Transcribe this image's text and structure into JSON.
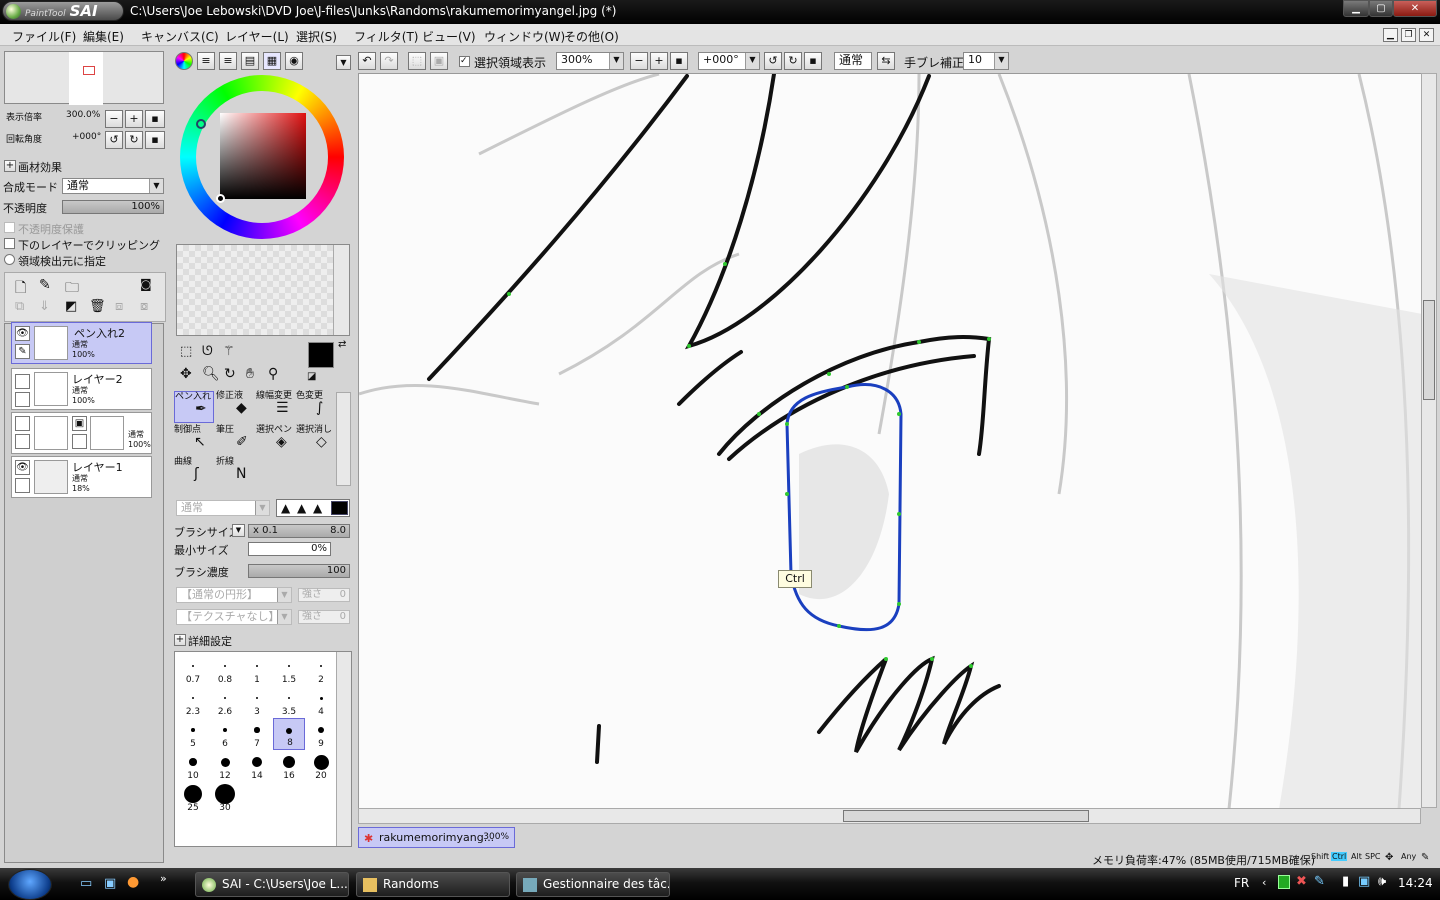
{
  "window": {
    "app_name": "PaintTool SAI",
    "title": "C:\\Users\\Joe Lebowski\\DVD Joe\\J-files\\Junks\\Randoms\\rakumemorimyangel.jpg (*)",
    "controls": [
      "minimize-icon",
      "maximize-icon",
      "close-icon"
    ]
  },
  "menu": {
    "items": [
      "ファイル(F)",
      "編集(E)",
      "キャンバス(C)",
      "レイヤー(L)",
      "選択(S)",
      "フィルタ(T)",
      "ビュー(V)",
      "ウィンドウ(W)",
      "その他(O)"
    ]
  },
  "navigator": {
    "zoom_label": "表示倍率",
    "zoom_value": "300.0%",
    "rotate_label": "回転角度",
    "rotate_value": "+000°"
  },
  "layer_props": {
    "effect_label": "画材効果",
    "blend_label": "合成モード",
    "blend_value": "通常",
    "opacity_label": "不透明度",
    "opacity_value": "100%",
    "opacity_fraction": 1.0,
    "protect_opacity": "不透明度保護",
    "clip_below": "下のレイヤーでクリッピング",
    "selection_source": "領域検出元に指定"
  },
  "layers": [
    {
      "name": "ペン入れ2",
      "mode": "通常",
      "opacity": "100%",
      "selected": true
    },
    {
      "name": "レイヤー2",
      "mode": "通常",
      "opacity": "100%",
      "selected": false
    },
    {
      "name": "",
      "mode": "通常",
      "opacity": "100%",
      "selected": false
    },
    {
      "name": "レイヤー1",
      "mode": "通常",
      "opacity": "18%",
      "selected": false
    }
  ],
  "tools": {
    "row1": [
      "ペン入れ",
      "修正液",
      "線幅変更",
      "色変更"
    ],
    "row2": [
      "制御点",
      "筆圧",
      "選択ペン",
      "選択消し"
    ],
    "row3": [
      "曲線",
      "折線"
    ]
  },
  "brush": {
    "mode_value": "通常",
    "size_label": "ブラシサイズ",
    "size_mult": "x 0.1",
    "size_value": "8.0",
    "min_size_label": "最小サイズ",
    "min_size_value": "0%",
    "density_label": "ブラシ濃度",
    "density_value": "100",
    "shape_value": "【通常の円形】",
    "texture_value": "【テクスチャなし】",
    "strength_label": "強さ",
    "strength_value": "0",
    "advanced_label": "詳細設定",
    "sizes": [
      "0.7",
      "0.8",
      "1",
      "1.5",
      "2",
      "2.3",
      "2.6",
      "3",
      "3.5",
      "4",
      "5",
      "6",
      "7",
      "8",
      "9",
      "10",
      "12",
      "14",
      "16",
      "20",
      "25",
      "30"
    ],
    "selected_size": "8"
  },
  "canvas_toolbar": {
    "show_selection": "選択領域表示",
    "zoom": "300%",
    "angle": "+000°",
    "blend": "通常",
    "stabilizer_label": "手ブレ補正",
    "stabilizer_value": "10"
  },
  "canvas": {
    "tooltip": "Ctrl"
  },
  "document_tab": {
    "name": "rakumemorimyang...",
    "zoom": "300%"
  },
  "status": {
    "memory": "メモリ負荷率:47% (85MB使用/715MB確保)",
    "keys": [
      "Shift",
      "Ctrl",
      "Alt",
      "SPC",
      "Any"
    ]
  },
  "taskbar": {
    "tasks": [
      "SAI - C:\\Users\\Joe L...",
      "Randoms",
      "Gestionnaire des tâc..."
    ],
    "language": "FR",
    "clock": "14:24"
  },
  "colors": {
    "selection": "#c7c9f5",
    "path_blue": "#1a3fbf",
    "control_point": "#2fc82f"
  }
}
